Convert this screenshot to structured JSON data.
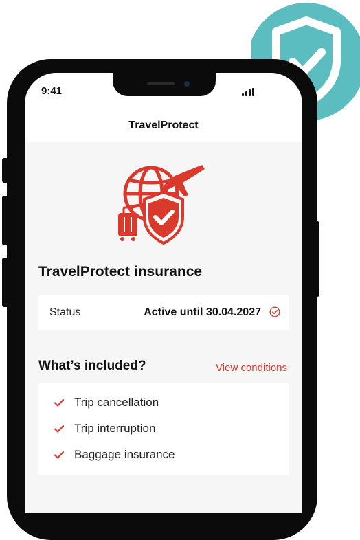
{
  "status_bar": {
    "time": "9:41"
  },
  "app": {
    "title": "TravelProtect"
  },
  "insurance": {
    "title": "TravelProtect insurance"
  },
  "status": {
    "label": "Status",
    "value": "Active until 30.04.2027"
  },
  "included": {
    "title": "What’s included?",
    "view_conditions": "View conditions",
    "items": [
      {
        "label": "Trip cancellation"
      },
      {
        "label": "Trip interruption"
      },
      {
        "label": "Baggage insurance"
      }
    ]
  },
  "colors": {
    "accent": "#d93a2b",
    "badge": "#5bbdbf",
    "frame": "#0b0b0b"
  },
  "icons": {
    "hero": "travel-insurance-icon",
    "badge": "shield-check-icon",
    "status": "check-circle-icon",
    "item": "check-icon"
  }
}
